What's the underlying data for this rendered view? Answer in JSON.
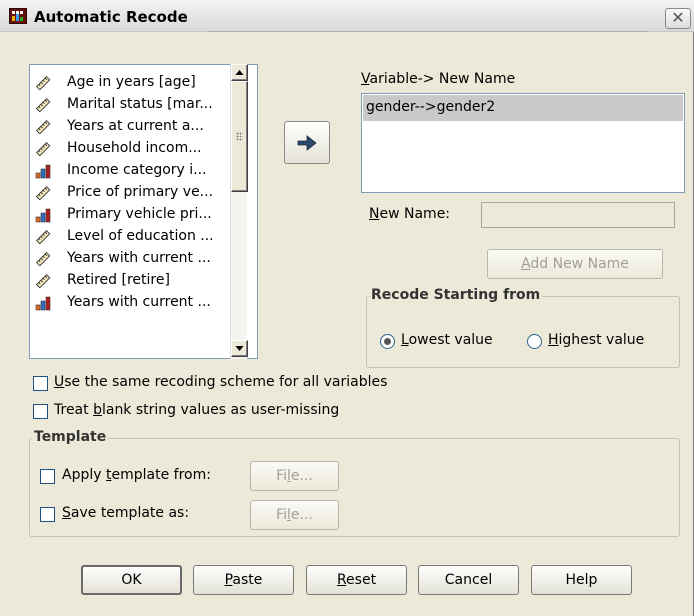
{
  "window": {
    "title": "Automatic Recode",
    "close_glyph": "✕"
  },
  "source_list": {
    "items": [
      {
        "label": "Age in years [age]",
        "icon": "scale-ruler-icon"
      },
      {
        "label": "Marital status [mar...",
        "icon": "scale-ruler-icon"
      },
      {
        "label": "Years at current a...",
        "icon": "scale-ruler-icon"
      },
      {
        "label": "Household incom...",
        "icon": "scale-ruler-icon"
      },
      {
        "label": "Income category i...",
        "icon": "ordinal-bars-icon"
      },
      {
        "label": "Price of primary ve...",
        "icon": "scale-ruler-icon"
      },
      {
        "label": "Primary vehicle pri...",
        "icon": "ordinal-bars-icon"
      },
      {
        "label": "Level of education ...",
        "icon": "scale-ruler-icon"
      },
      {
        "label": "Years with current ...",
        "icon": "scale-ruler-icon"
      },
      {
        "label": "Retired [retire]",
        "icon": "scale-ruler-icon"
      },
      {
        "label": "Years with current ...",
        "icon": "ordinal-bars-icon"
      }
    ]
  },
  "variable_new_name": {
    "label_accel": "V",
    "label_rest": "ariable-> New Name",
    "selected_value": "gender-->gender2"
  },
  "new_name": {
    "label_accel": "N",
    "label_rest": "ew Name:",
    "value": ""
  },
  "add_new_name": {
    "label_accel": "A",
    "label_rest": "dd New Name"
  },
  "recode_start": {
    "title": "Recode Starting from",
    "lowest_accel": "L",
    "lowest_rest": "owest value",
    "highest_accel": "H",
    "highest_rest": "ighest value",
    "selected": "lowest"
  },
  "options": {
    "same_scheme_accel": "U",
    "same_scheme_rest": "se the same recoding scheme for all variables",
    "blank_pre": "Treat ",
    "blank_accel": "b",
    "blank_rest": "lank string values as user-missing"
  },
  "template": {
    "title": "Template",
    "apply_pre": "Apply ",
    "apply_accel": "t",
    "apply_rest": "emplate from:",
    "save_accel": "S",
    "save_rest": "ave template as:",
    "file_pre": "Fi",
    "file_accel": "l",
    "file_rest": "e..."
  },
  "buttons": {
    "ok": "OK",
    "paste_accel": "P",
    "paste_rest": "aste",
    "reset_accel": "R",
    "reset_rest": "eset",
    "cancel": "Cancel",
    "help": "Help"
  },
  "colors": {
    "dialog_bg": "#ece9d8",
    "selection": "#c9c9c9",
    "disabled_text": "#a19f97"
  }
}
